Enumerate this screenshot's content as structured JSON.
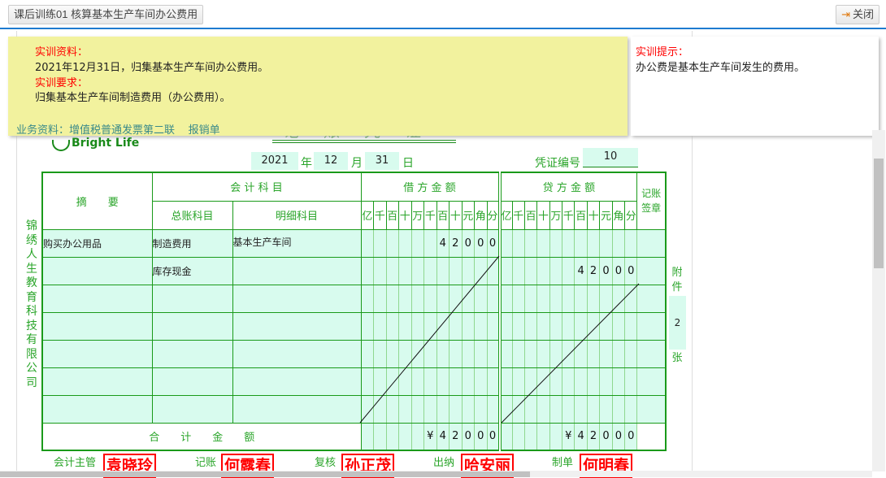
{
  "header": {
    "title": "课后训练01 核算基本生产车间办公费用",
    "close_label": "关闭"
  },
  "panel": {
    "material_label": "实训资料：",
    "material_text": "2021年12月31日，归集基本生产车间办公费用。",
    "requirement_label": "实训要求：",
    "requirement_text": "归集基本生产车间制造费用（办公费用）。",
    "business_label": "业务资料：",
    "links": [
      "增值税普通发票第二联",
      "报销单"
    ]
  },
  "hint": {
    "label": "实训提示：",
    "text": "办公费是基本生产车间发生的费用。"
  },
  "voucher": {
    "title": "记账凭证",
    "logo": "Bright Life",
    "year": "2021",
    "year_label": "年",
    "month": "12",
    "month_label": "月",
    "day": "31",
    "day_label": "日",
    "number_label": "凭证编号",
    "number": "10",
    "company": "锦绣人生教育科技有限公司",
    "headers": {
      "summary": "摘　　要",
      "subject": "会 计 科 目",
      "general": "总账科目",
      "detail": "明细科目",
      "debit": "借 方 金 额",
      "credit": "贷 方 金 额",
      "post": "记账签章"
    },
    "digits": [
      "亿",
      "千",
      "百",
      "十",
      "万",
      "千",
      "百",
      "十",
      "元",
      "角",
      "分"
    ],
    "rows": [
      {
        "summary": "购买办公用品",
        "general": "制造费用",
        "detail": "基本生产车间",
        "debit": [
          "",
          "",
          "",
          "",
          "",
          "",
          "4",
          "2",
          "0",
          "0",
          "0"
        ],
        "credit": [
          "",
          "",
          "",
          "",
          "",
          "",
          "",
          "",
          "",
          "",
          ""
        ]
      },
      {
        "summary": "",
        "general": "库存现金",
        "detail": "",
        "debit": [
          "",
          "",
          "",
          "",
          "",
          "",
          "",
          "",
          "",
          "",
          ""
        ],
        "credit": [
          "",
          "",
          "",
          "",
          "",
          "",
          "4",
          "2",
          "0",
          "0",
          "0"
        ]
      },
      {
        "summary": "",
        "general": "",
        "detail": "",
        "debit": [
          "",
          "",
          "",
          "",
          "",
          "",
          "",
          "",
          "",
          "",
          ""
        ],
        "credit": [
          "",
          "",
          "",
          "",
          "",
          "",
          "",
          "",
          "",
          "",
          ""
        ]
      },
      {
        "summary": "",
        "general": "",
        "detail": "",
        "debit": [
          "",
          "",
          "",
          "",
          "",
          "",
          "",
          "",
          "",
          "",
          ""
        ],
        "credit": [
          "",
          "",
          "",
          "",
          "",
          "",
          "",
          "",
          "",
          "",
          ""
        ]
      },
      {
        "summary": "",
        "general": "",
        "detail": "",
        "debit": [
          "",
          "",
          "",
          "",
          "",
          "",
          "",
          "",
          "",
          "",
          ""
        ],
        "credit": [
          "",
          "",
          "",
          "",
          "",
          "",
          "",
          "",
          "",
          "",
          ""
        ]
      },
      {
        "summary": "",
        "general": "",
        "detail": "",
        "debit": [
          "",
          "",
          "",
          "",
          "",
          "",
          "",
          "",
          "",
          "",
          ""
        ],
        "credit": [
          "",
          "",
          "",
          "",
          "",
          "",
          "",
          "",
          "",
          "",
          ""
        ]
      },
      {
        "summary": "",
        "general": "",
        "detail": "",
        "debit": [
          "",
          "",
          "",
          "",
          "",
          "",
          "",
          "",
          "",
          "",
          ""
        ],
        "credit": [
          "",
          "",
          "",
          "",
          "",
          "",
          "",
          "",
          "",
          "",
          ""
        ]
      }
    ],
    "total_label": "合　　计　　金　　额",
    "total_debit": [
      "",
      "",
      "",
      "",
      "",
      "¥",
      "4",
      "2",
      "0",
      "0",
      "0"
    ],
    "total_credit": [
      "",
      "",
      "",
      "",
      "",
      "¥",
      "4",
      "2",
      "0",
      "0",
      "0"
    ],
    "attachment_label_top": "附件",
    "attachments": "2",
    "attachment_label_bottom": "张",
    "signatures": [
      {
        "role": "会计主管",
        "name": "袁晓玲"
      },
      {
        "role": "记账",
        "name": "何露春"
      },
      {
        "role": "复核",
        "name": "孙正茂"
      },
      {
        "role": "出纳",
        "name": "哈安丽"
      },
      {
        "role": "制单",
        "name": "何明春"
      }
    ]
  }
}
